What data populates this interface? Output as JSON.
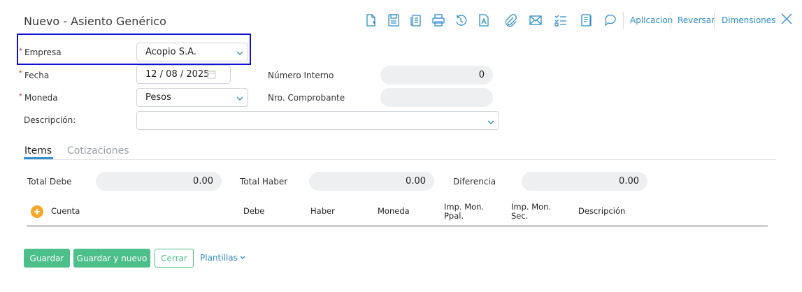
{
  "header": {
    "title": "Nuevo - Asiento Genérico",
    "toolbar_icons": [
      "new-document-icon",
      "save-icon",
      "copy-icon",
      "print-icon",
      "history-icon",
      "text-icon",
      "attach-icon",
      "mail-icon",
      "checklist-icon",
      "notes-icon",
      "comment-icon"
    ],
    "links": {
      "aplicacion": "Aplicacion",
      "reversar": "Reversar",
      "dimensiones": "Dimensiones"
    }
  },
  "form": {
    "required_mark": "*",
    "empresa": {
      "label": "Empresa",
      "value": "Acopio S.A."
    },
    "fecha": {
      "label": "Fecha",
      "value": "12 / 08 / 2025"
    },
    "moneda": {
      "label": "Moneda",
      "value": "Pesos"
    },
    "descripcion": {
      "label": "Descripción:",
      "value": ""
    },
    "numero_interno": {
      "label": "Número Interno",
      "value": "0"
    },
    "nro_comprobante": {
      "label": "Nro. Comprobante",
      "value": ""
    }
  },
  "tabs": [
    {
      "label": "Items"
    },
    {
      "label": "Cotizaciones"
    }
  ],
  "totals": {
    "total_debe": {
      "label": "Total Debe",
      "value": "0.00"
    },
    "total_haber": {
      "label": "Total Haber",
      "value": "0.00"
    },
    "diferencia": {
      "label": "Diferencia",
      "value": "0.00"
    }
  },
  "table": {
    "columns": {
      "cuenta": "Cuenta",
      "debe": "Debe",
      "haber": "Haber",
      "moneda": "Moneda",
      "imp_ppal_1": "Imp. Mon.",
      "imp_ppal_2": "Ppal.",
      "imp_sec_1": "Imp. Mon.",
      "imp_sec_2": "Sec.",
      "descripcion": "Descripción"
    }
  },
  "footer": {
    "guardar": "Guardar",
    "guardar_nuevo": "Guardar y nuevo",
    "cerrar": "Cerrar",
    "plantillas": "Plantillas"
  },
  "colors": {
    "accent": "#2f8fcf",
    "green": "#4cbf8a",
    "required": "#e0413b",
    "highlight": "#1010d8",
    "add": "#f4a92a"
  }
}
